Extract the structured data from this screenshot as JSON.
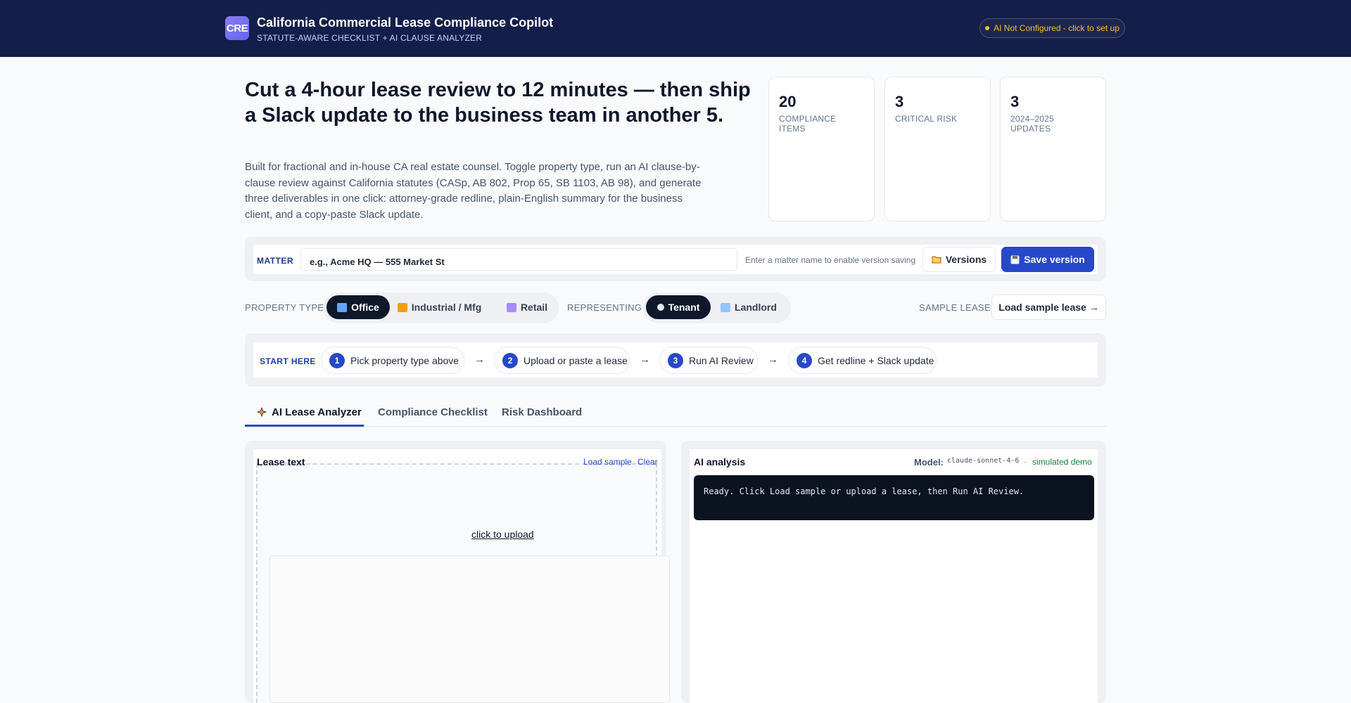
{
  "header": {
    "logo_text": "CRE",
    "title": "California Commercial Lease Compliance Copilot",
    "subtitle": "STATUTE-AWARE CHECKLIST + AI CLAUSE ANALYZER",
    "ai_status": "AI Not Configured - click to set up"
  },
  "hero": {
    "title": "Cut a 4-hour lease review to 12 minutes — then ship a Slack update to the business team in another 5.",
    "description": "Built for fractional and in-house CA real estate counsel. Toggle property type, run an AI clause-by-clause review against California statutes (CASp, AB 802, Prop 65, SB 1103, AB 98), and generate three deliverables in one click: attorney-grade redline, plain-English summary for the business client, and a copy-paste Slack update."
  },
  "stats": [
    {
      "value": "20",
      "label": "COMPLIANCE ITEMS"
    },
    {
      "value": "3",
      "label": "CRITICAL RISK"
    },
    {
      "value": "3",
      "label": "2024–2025 UPDATES"
    }
  ],
  "matter": {
    "label": "MATTER",
    "placeholder": "e.g., Acme HQ — 555 Market St",
    "hint": "Enter a matter name to enable version saving",
    "versions_label": "Versions",
    "save_label": "Save version"
  },
  "property": {
    "label": "PROPERTY TYPE",
    "options": [
      "Office",
      "Industrial / Mfg",
      "Retail"
    ],
    "selected": "Office"
  },
  "representing": {
    "label": "REPRESENTING",
    "options": [
      "Tenant",
      "Landlord"
    ],
    "selected": "Tenant"
  },
  "sample": {
    "label": "SAMPLE LEASE",
    "button": "Load sample lease →"
  },
  "steps": {
    "label": "START HERE",
    "items": [
      {
        "n": "1",
        "text": "Pick property type above"
      },
      {
        "n": "2",
        "text": "Upload or paste a lease"
      },
      {
        "n": "3",
        "text": "Run AI Review"
      },
      {
        "n": "4",
        "text": "Get redline + Slack update"
      }
    ],
    "arrow": "→"
  },
  "tabs": [
    {
      "label": "AI Lease Analyzer",
      "active": true
    },
    {
      "label": "Compliance Checklist",
      "active": false
    },
    {
      "label": "Risk Dashboard",
      "active": false
    }
  ],
  "lease": {
    "title": "Lease text",
    "load_sample": "Load sample",
    "clear": "Clear",
    "upload": "click to upload"
  },
  "analysis": {
    "title": "AI analysis",
    "model_label": "Model:",
    "model": "claude-sonnet-4-6",
    "separator": "·",
    "mode": "simulated demo",
    "console": "Ready. Click Load sample or upload a lease, then Run AI Review."
  },
  "colors": {
    "header_bg": "#131e4a",
    "accent": "#2748c9",
    "warning": "#fbbf24",
    "success": "#15803d"
  }
}
